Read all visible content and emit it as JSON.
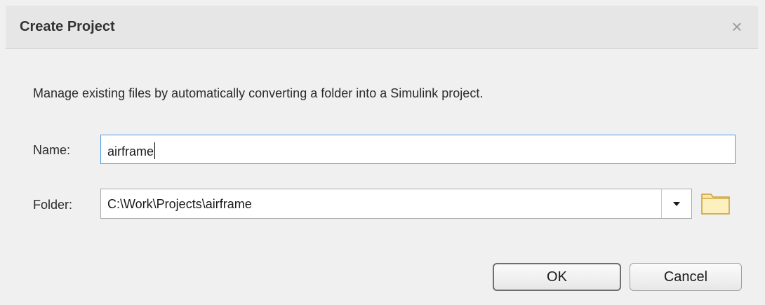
{
  "dialog": {
    "title": "Create Project",
    "close_glyph": "×"
  },
  "description": "Manage existing files by automatically converting a folder into a Simulink project.",
  "name_field": {
    "label": "Name:",
    "value": "airframe"
  },
  "folder_field": {
    "label": "Folder:",
    "value": "C:\\Work\\Projects\\airframe"
  },
  "buttons": {
    "ok_label": "OK",
    "cancel_label": "Cancel"
  },
  "icons": {
    "close": "close-icon",
    "dropdown": "chevron-down-icon",
    "browse": "folder-icon"
  },
  "colors": {
    "focus_border": "#4d9be0",
    "folder_icon_fill": "#fbe7a3",
    "folder_icon_stroke": "#c99e3a"
  }
}
